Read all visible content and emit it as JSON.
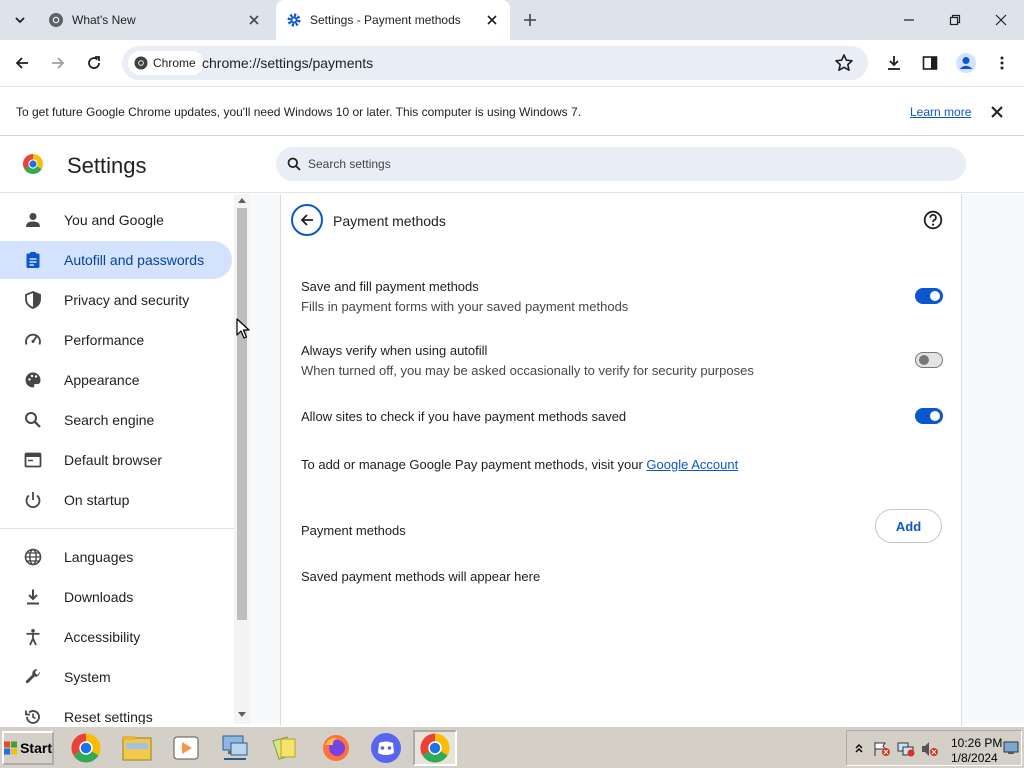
{
  "tabs": [
    {
      "title": "What's New",
      "active": false
    },
    {
      "title": "Settings - Payment methods",
      "active": true
    }
  ],
  "toolbar": {
    "chip_label": "Chrome",
    "url": "chrome://settings/payments"
  },
  "infobar": {
    "message": "To get future Google Chrome updates, you'll need Windows 10 or later. This computer is using Windows 7.",
    "learn_more": "Learn more"
  },
  "header": {
    "title": "Settings",
    "search_placeholder": "Search settings"
  },
  "sidebar": {
    "items": [
      {
        "label": "You and Google",
        "icon": "person-icon",
        "active": false
      },
      {
        "label": "Autofill and passwords",
        "icon": "clipboard-icon",
        "active": true
      },
      {
        "label": "Privacy and security",
        "icon": "shield-icon",
        "active": false
      },
      {
        "label": "Performance",
        "icon": "speedometer-icon",
        "active": false
      },
      {
        "label": "Appearance",
        "icon": "palette-icon",
        "active": false
      },
      {
        "label": "Search engine",
        "icon": "search-icon",
        "active": false
      },
      {
        "label": "Default browser",
        "icon": "browser-icon",
        "active": false
      },
      {
        "label": "On startup",
        "icon": "power-icon",
        "active": false
      },
      {
        "label": "Languages",
        "icon": "globe-icon",
        "active": false
      },
      {
        "label": "Downloads",
        "icon": "download-icon",
        "active": false
      },
      {
        "label": "Accessibility",
        "icon": "accessibility-icon",
        "active": false
      },
      {
        "label": "System",
        "icon": "wrench-icon",
        "active": false
      },
      {
        "label": "Reset settings",
        "icon": "reset-icon",
        "active": false
      }
    ]
  },
  "main": {
    "heading": "Payment methods",
    "settings": [
      {
        "label": "Save and fill payment methods",
        "sub": "Fills in payment forms with your saved payment methods",
        "on": true
      },
      {
        "label": "Always verify when using autofill",
        "sub": "When turned off, you may be asked occasionally to verify for security purposes",
        "on": false
      },
      {
        "label": "Allow sites to check if you have payment methods saved",
        "sub": "",
        "on": true
      }
    ],
    "gpay_text": "To add or manage Google Pay payment methods, visit your",
    "gpay_link": "Google Account",
    "section_heading": "Payment methods",
    "add_label": "Add",
    "empty_text": "Saved payment methods will appear here"
  },
  "taskbar": {
    "start_label": "Start",
    "time": "10:26 PM",
    "date": "1/8/2024"
  },
  "colors": {
    "accent": "#0b57d0",
    "active_nav": "#d3e3fd",
    "tabstrip": "#dde3ea"
  }
}
